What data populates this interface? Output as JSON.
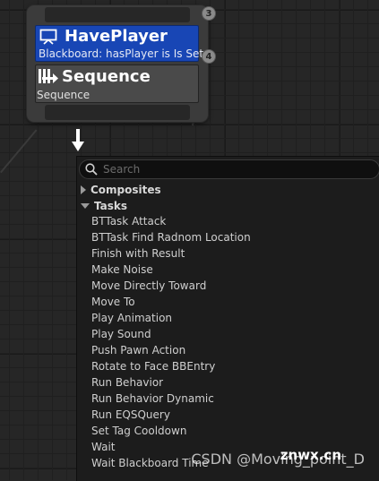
{
  "node": {
    "decorator": {
      "title": "HavePlayer",
      "subtitle": "Blackboard: hasPlayer is Is Set",
      "index_badge": "4",
      "icon": "blackboard-monitor-icon",
      "color": "#1846b5"
    },
    "composite": {
      "title": "Sequence",
      "subtitle": "Sequence",
      "icon": "sequence-icon"
    },
    "top_index_badge": "3"
  },
  "menu": {
    "search_placeholder": "Search",
    "categories": [
      {
        "label": "Composites",
        "expanded": false
      },
      {
        "label": "Tasks",
        "expanded": true
      }
    ],
    "tasks": [
      "BTTask Attack",
      "BTTask Find Radnom Location",
      "Finish with Result",
      "Make Noise",
      "Move Directly Toward",
      "Move To",
      "Play Animation",
      "Play Sound",
      "Push Pawn Action",
      "Rotate to Face BBEntry",
      "Run Behavior",
      "Run Behavior Dynamic",
      "Run EQSQuery",
      "Set Tag Cooldown",
      "Wait",
      "Wait Blackboard Time"
    ]
  },
  "watermark": "CSDN @Moving_point_D",
  "watermark_logo": "znwx.cn"
}
